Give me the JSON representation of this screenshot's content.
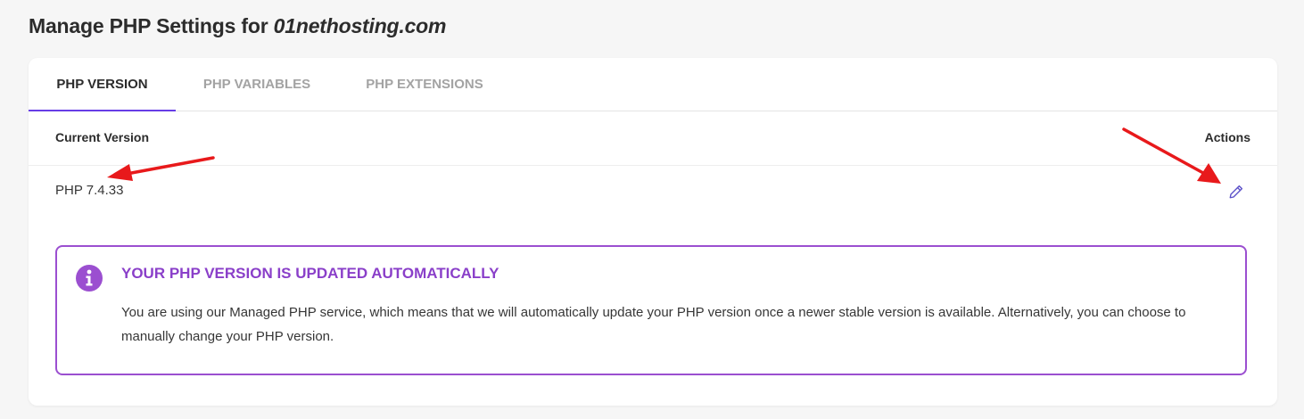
{
  "page": {
    "title_prefix": "Manage PHP Settings for ",
    "domain": "01nethosting.com"
  },
  "tabs": [
    {
      "label": "PHP VERSION",
      "active": true
    },
    {
      "label": "PHP VARIABLES",
      "active": false
    },
    {
      "label": "PHP EXTENSIONS",
      "active": false
    }
  ],
  "table": {
    "header_current": "Current Version",
    "header_actions": "Actions",
    "current_version": "PHP 7.4.33",
    "edit_icon": "pencil-icon"
  },
  "notice": {
    "icon": "info-icon",
    "title": "YOUR PHP VERSION IS UPDATED AUTOMATICALLY",
    "text": "You are using our Managed PHP service, which means that we will automatically update your PHP version once a newer stable version is available. Alternatively, you can choose to manually change your PHP version."
  },
  "colors": {
    "accent": "#673de6",
    "notice_border": "#9b4fd0",
    "notice_title": "#8a3fc9",
    "annotation_arrow": "#e8191b"
  }
}
